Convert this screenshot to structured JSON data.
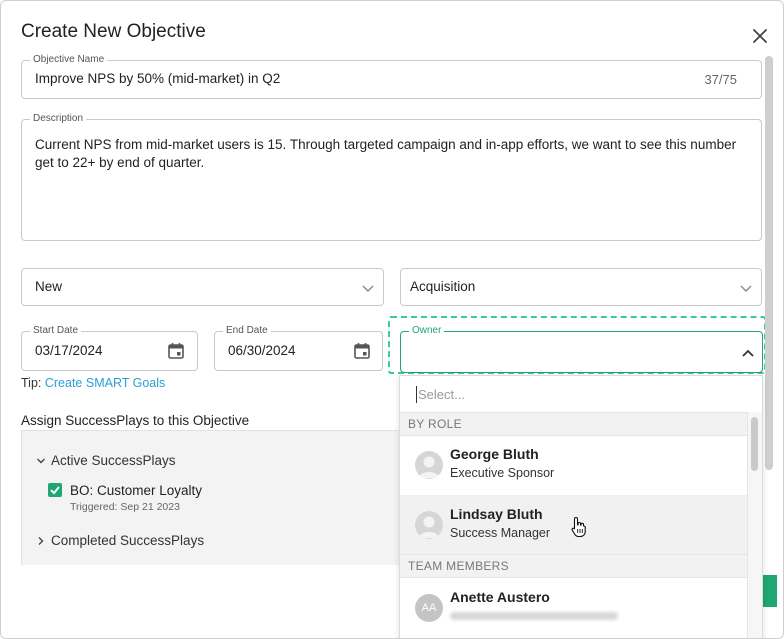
{
  "dialog": {
    "title": "Create New Objective"
  },
  "objective_name": {
    "label": "Objective Name",
    "value": "Improve NPS by 50% (mid-market) in Q2",
    "counter": "37/75"
  },
  "description": {
    "label": "Description",
    "value": "Current NPS from mid-market users is 15. Through targeted campaign and in-app efforts, we want to see this number get to 22+ by end of quarter."
  },
  "status_select": {
    "value": "New"
  },
  "category_select": {
    "value": "Acquisition"
  },
  "start_date": {
    "label": "Start Date",
    "value": "03/17/2024"
  },
  "end_date": {
    "label": "End Date",
    "value": "06/30/2024"
  },
  "owner": {
    "label": "Owner",
    "value": "",
    "search_placeholder": "Select...",
    "groups": [
      {
        "title": "BY ROLE",
        "options": [
          {
            "name": "George Bluth",
            "subtitle": "Executive Sponsor"
          },
          {
            "name": "Lindsay Bluth",
            "subtitle": "Success Manager"
          }
        ]
      },
      {
        "title": "TEAM MEMBERS",
        "options": [
          {
            "name": "Anette Austero",
            "initials": "AA"
          }
        ]
      }
    ]
  },
  "tip": {
    "prefix": "Tip:",
    "link": "Create SMART Goals"
  },
  "successplays": {
    "title": "Assign SuccessPlays to this Objective",
    "active_group": "Active SuccessPlays",
    "items": [
      {
        "name": "BO: Customer Loyalty",
        "triggered": "Triggered: Sep 21 2023",
        "checked": true
      }
    ],
    "completed_group": "Completed SuccessPlays"
  },
  "colors": {
    "accent": "#1fa672",
    "focus_outline": "#3cc9a0",
    "link": "#2a9fd6"
  },
  "icons": [
    "close-icon",
    "chevron-down-icon",
    "calendar-icon",
    "chevron-up-icon",
    "chevron-right-icon",
    "user-avatar-icon",
    "checkbox-checked-icon",
    "hand-pointer-cursor"
  ]
}
